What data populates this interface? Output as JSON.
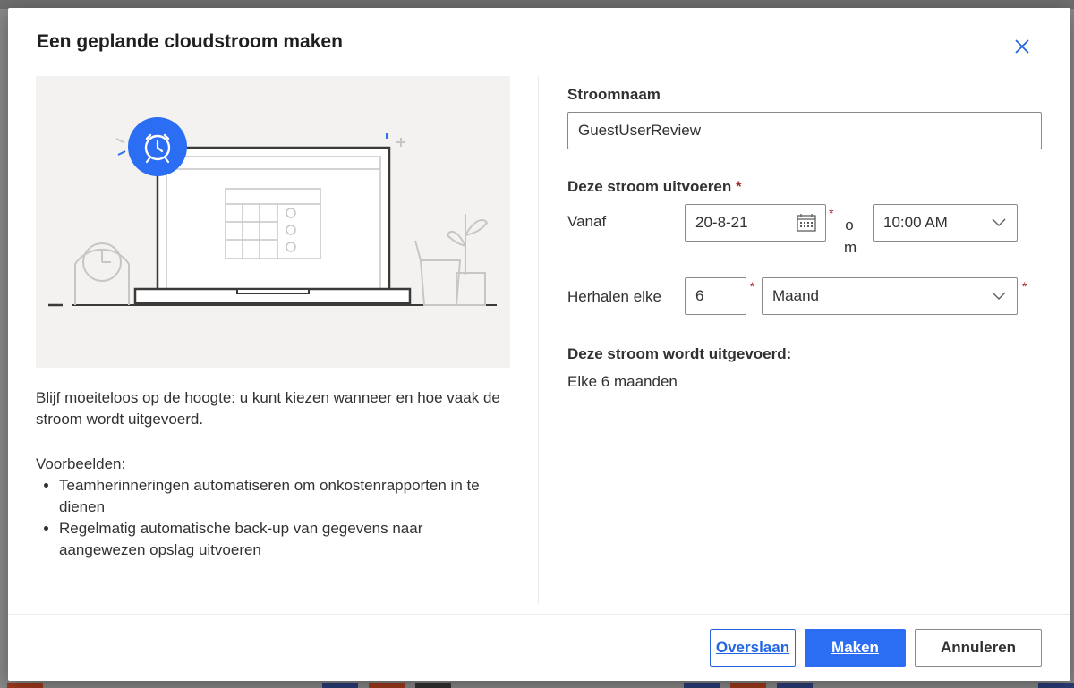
{
  "dialog": {
    "title": "Een geplande cloudstroom maken",
    "description": "Blijf moeiteloos op de hoogte: u kunt kiezen wanneer en hoe vaak de stroom wordt uitgevoerd.",
    "examples_label": "Voorbeelden:",
    "examples": [
      "Teamherinneringen automatiseren om onkostenrapporten in te dienen",
      "Regelmatig automatische back-up van gegevens naar aangewezen opslag uitvoeren"
    ]
  },
  "form": {
    "flow_name_label": "Stroomnaam",
    "flow_name_value": "GuestUserReview",
    "run_label": "Deze stroom uitvoeren",
    "required_mark": "*",
    "start_label": "Vanaf",
    "start_date": "20-8-21",
    "at_label": "om",
    "start_time": "10:00 AM",
    "repeat_label": "Herhalen elke",
    "repeat_interval": "6",
    "repeat_unit": "Maand",
    "summary_label": "Deze stroom wordt uitgevoerd:",
    "summary_value": "Elke 6 maanden"
  },
  "footer": {
    "skip_label": "Overslaan",
    "create_label": "Maken",
    "cancel_label": "Annuleren"
  },
  "colors": {
    "primary": "#2b6ef4",
    "required": "#a4262c",
    "illustration_bg": "#f3f2f1"
  },
  "icons": [
    "close-icon",
    "calendar-icon",
    "chevron-down-icon",
    "alarm-clock-icon"
  ]
}
